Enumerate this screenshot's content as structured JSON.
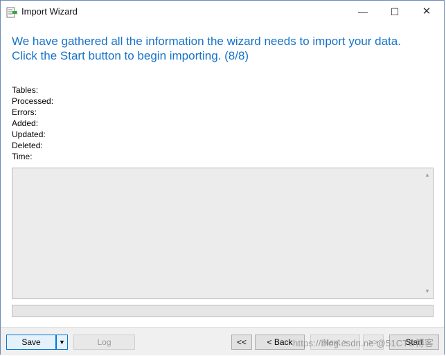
{
  "window": {
    "title": "Import Wizard",
    "controls": {
      "minimize": "—",
      "maximize": "☐",
      "close": "✕"
    }
  },
  "heading": {
    "line1": "We have gathered all the information the wizard needs to import your data.",
    "line2": "Click the Start button to begin importing. (8/8)"
  },
  "stats": [
    {
      "label": "Tables:"
    },
    {
      "label": "Processed:"
    },
    {
      "label": "Errors:"
    },
    {
      "label": "Added:"
    },
    {
      "label": "Updated:"
    },
    {
      "label": "Deleted:"
    },
    {
      "label": "Time:"
    }
  ],
  "log": {
    "scroll_up": "▲",
    "scroll_down": "▼"
  },
  "progress": {
    "value": 0
  },
  "footer": {
    "save_label": "Save",
    "save_dropdown_glyph": "▼",
    "log_label": "Log",
    "first_label": "<<",
    "back_label": "< Back",
    "next_label": "Next >",
    "last_label": ">>",
    "start_label": "Start"
  },
  "watermark": "https://blog.csdn.ne @51CTO博客",
  "colors": {
    "heading": "#1672c9",
    "accent": "#0078d7"
  }
}
